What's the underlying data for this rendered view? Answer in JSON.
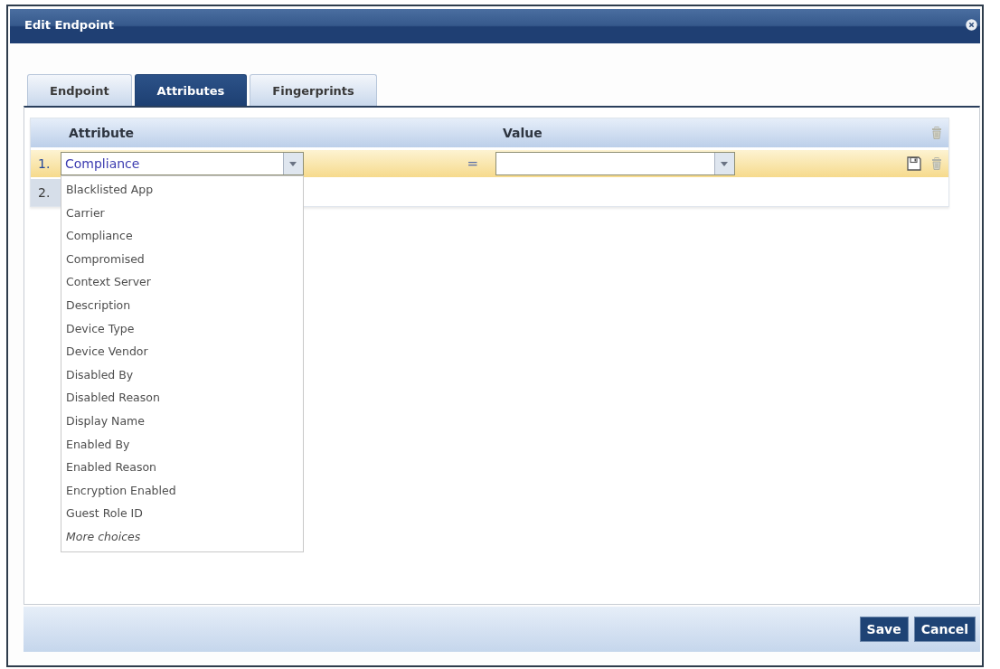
{
  "window": {
    "title": "Edit Endpoint"
  },
  "tabs": [
    {
      "label": "Endpoint",
      "selected": false
    },
    {
      "label": "Attributes",
      "selected": true
    },
    {
      "label": "Fingerprints",
      "selected": false
    }
  ],
  "table": {
    "columns": [
      "Attribute",
      "Value"
    ],
    "rows": [
      {
        "number": "1.",
        "selected": true,
        "attribute": {
          "value": "Compliance",
          "expanded": true,
          "options": [
            "Blacklisted App",
            "Carrier",
            "Compliance",
            "Compromised",
            "Context Server",
            "Description",
            "Device Type",
            "Device Vendor",
            "Disabled By",
            "Disabled Reason",
            "Display Name",
            "Enabled By",
            "Enabled Reason",
            "Encryption Enabled",
            "Guest Role ID"
          ],
          "more": "More choices"
        },
        "operator": "="
      },
      {
        "number": "2.",
        "selected": false
      }
    ]
  },
  "buttons": [
    "Save",
    "Cancel"
  ]
}
